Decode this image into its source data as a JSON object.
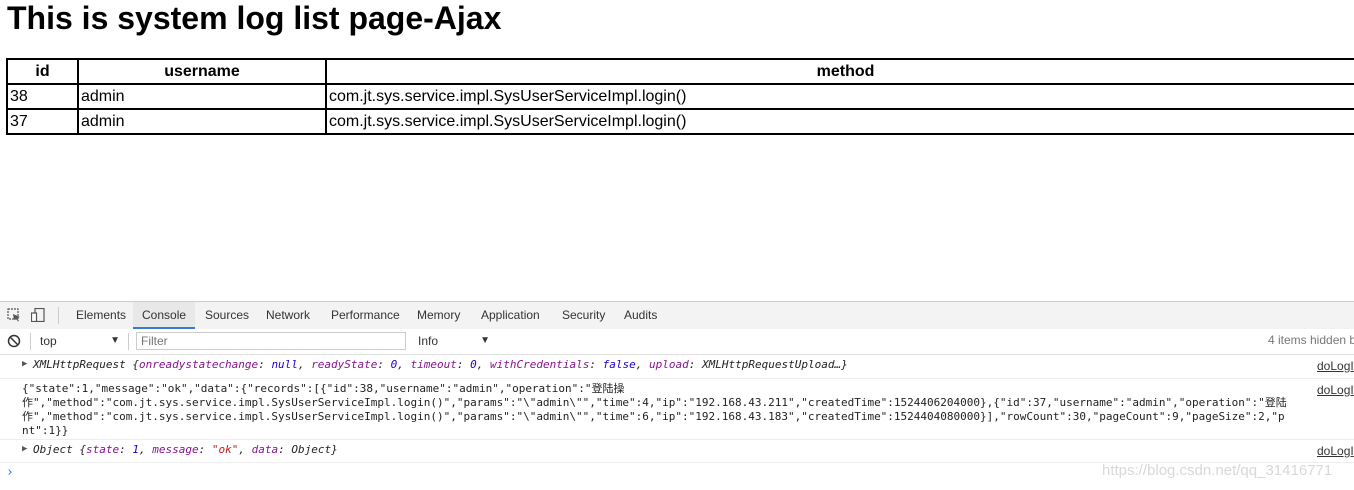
{
  "page": {
    "title": "This is system log list page-Ajax"
  },
  "table": {
    "headers": [
      "id",
      "username",
      "method"
    ],
    "rows": [
      {
        "id": "38",
        "username": "admin",
        "method": "com.jt.sys.service.impl.SysUserServiceImpl.login()"
      },
      {
        "id": "37",
        "username": "admin",
        "method": "com.jt.sys.service.impl.SysUserServiceImpl.login()"
      }
    ]
  },
  "devtools": {
    "tabs": [
      "Elements",
      "Console",
      "Sources",
      "Network",
      "Performance",
      "Memory",
      "Application",
      "Security",
      "Audits"
    ],
    "active_tab": "Console",
    "toolbar": {
      "context": "top",
      "filter_placeholder": "Filter",
      "level": "Info",
      "hidden_count": "4 items hidden b"
    },
    "messages": [
      {
        "prefix": "XMLHttpRequest {",
        "k1": "onreadystatechange",
        "v1": "null",
        "k2": "readyState",
        "v2": "0",
        "k3": "timeout",
        "v3": "0",
        "k4": "withCredentials",
        "v4": "false",
        "k5": "upload",
        "v5": "XMLHttpRequestUpload…}",
        "source": "doLogI"
      },
      {
        "json_line1": "{\"state\":1,\"message\":\"ok\",\"data\":{\"records\":[{\"id\":38,\"username\":\"admin\",\"operation\":\"登陆操",
        "json_line2": "作\",\"method\":\"com.jt.sys.service.impl.SysUserServiceImpl.login()\",\"params\":\"\\\"admin\\\"\",\"time\":4,\"ip\":\"192.168.43.211\",\"createdTime\":1524406204000},{\"id\":37,\"username\":\"admin\",\"operation\":\"登陆",
        "json_line3": "作\",\"method\":\"com.jt.sys.service.impl.SysUserServiceImpl.login()\",\"params\":\"\\\"admin\\\"\",\"time\":6,\"ip\":\"192.168.43.183\",\"createdTime\":1524404080000}],\"rowCount\":30,\"pageCount\":9,\"pageSize\":2,\"p",
        "json_line4": "nt\":1}}",
        "source": "doLogI"
      },
      {
        "prefix": "Object {",
        "k1": "state",
        "v1": "1",
        "k2": "message",
        "v2": "\"ok\"",
        "k3": "data",
        "v3": "Object}",
        "source": "doLogI"
      }
    ],
    "prompt": "›"
  },
  "watermark": "https://blog.csdn.net/qq_31416771"
}
